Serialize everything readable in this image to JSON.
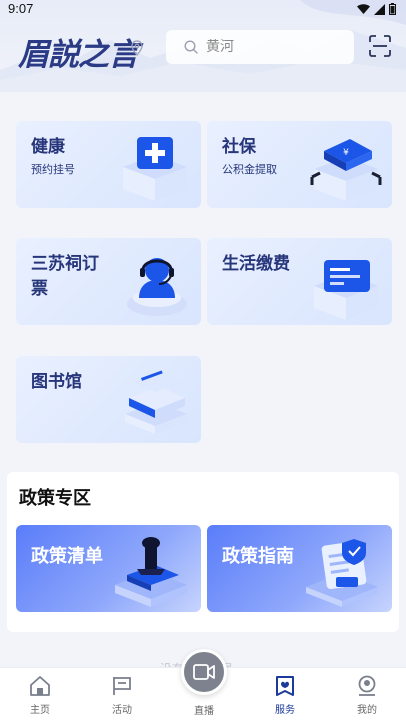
{
  "status": {
    "time": "9:07"
  },
  "header": {
    "logo": "眉説之言",
    "search_placeholder": "黄河"
  },
  "services": [
    {
      "title": "健康",
      "subtitle": "预约挂号"
    },
    {
      "title": "社保",
      "subtitle": "公积金提取"
    },
    {
      "title": "三苏祠订票",
      "subtitle": ""
    },
    {
      "title": "生活缴费",
      "subtitle": ""
    },
    {
      "title": "图书馆",
      "subtitle": ""
    }
  ],
  "policy": {
    "section_title": "政策专区",
    "cards": [
      {
        "title": "政策清单"
      },
      {
        "title": "政策指南"
      }
    ]
  },
  "footer_faint_text": "没有更多数据",
  "nav": {
    "home": "主页",
    "activity": "活动",
    "live": "直播",
    "service": "服务",
    "mine": "我的"
  },
  "colors": {
    "accent": "#1b3a9a",
    "card_bg": "#dde8fe",
    "policy_card": "#5a7dfa"
  }
}
